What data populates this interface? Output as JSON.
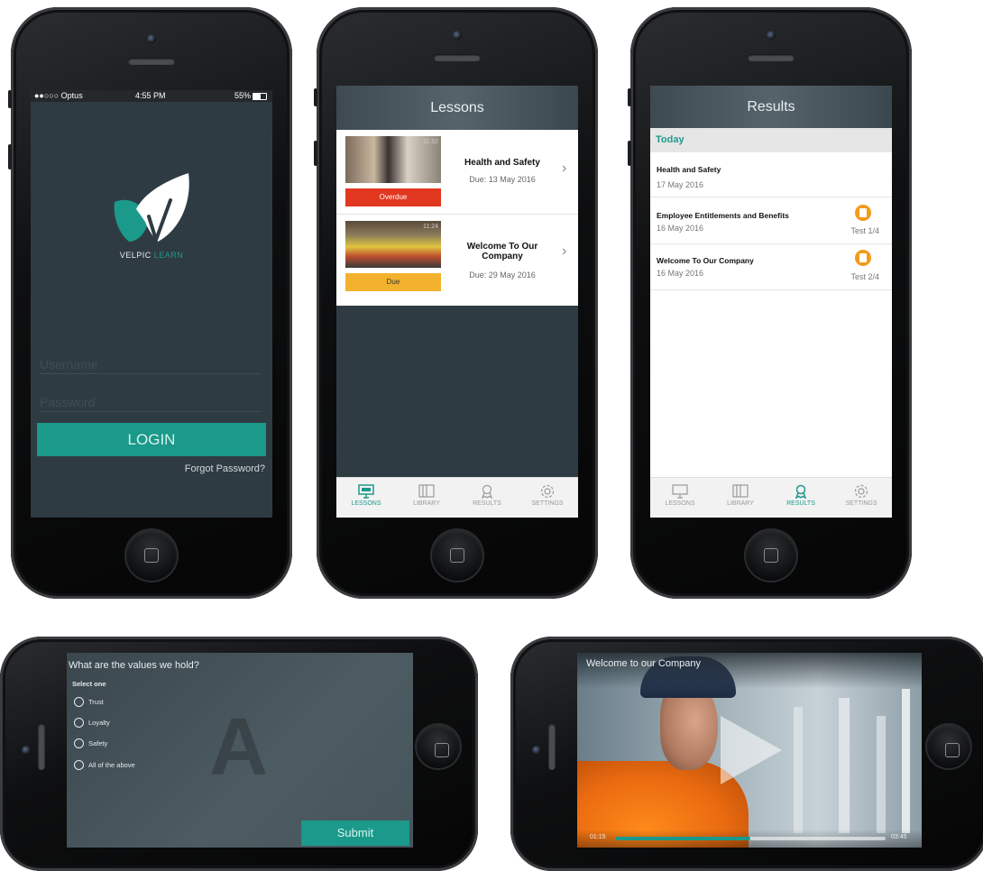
{
  "login": {
    "status_carrier": "●●○○○ Optus",
    "status_time": "4:55 PM",
    "status_battery": "55%",
    "brand_first": "VELPIC",
    "brand_second": "LEARN",
    "username_placeholder": "Username",
    "password_placeholder": "Password",
    "login_label": "LOGIN",
    "forgot_label": "Forgot Password?"
  },
  "lessons": {
    "title": "Lessons",
    "items": [
      {
        "title": "Health and Safety",
        "due": "Due: 13 May 2016",
        "status": "Overdue",
        "status_color": "#e1381f",
        "thumb_time": "11:32"
      },
      {
        "title": "Welcome To Our Company",
        "due": "Due: 29 May 2016",
        "status": "Due",
        "status_color": "#f3b22d",
        "thumb_time": "11:24"
      }
    ]
  },
  "tabs": {
    "lessons": "LESSONS",
    "library": "LIBRARY",
    "results": "RESULTS",
    "settings": "SETTINGS"
  },
  "results": {
    "title": "Results",
    "section": "Today",
    "items": [
      {
        "title": "Health and Safety",
        "date": "17 May 2016",
        "test": ""
      },
      {
        "title": "Employee Entitlements and Benefits",
        "date": "16 May 2016",
        "test": "Test 1/4"
      },
      {
        "title": "Welcome To Our Company",
        "date": "16 May 2016",
        "test": "Test 2/4"
      }
    ]
  },
  "quiz": {
    "question": "What are the values we hold?",
    "instruction": "Select one",
    "options": [
      "Trust",
      "Loyalty",
      "Safety",
      "All of the above"
    ],
    "watermark": "A",
    "submit_label": "Submit"
  },
  "video": {
    "title": "Welcome to our Company",
    "elapsed": "01:15",
    "duration": "03:45",
    "progress": 0.5
  },
  "colors": {
    "accent": "#1b998a",
    "screen_bg": "#2f3b42"
  }
}
